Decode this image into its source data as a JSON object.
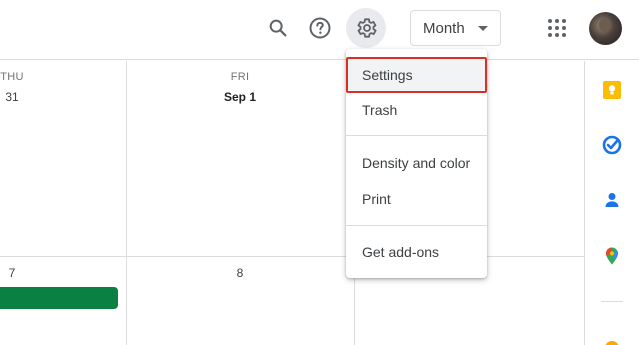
{
  "header": {
    "view_selector": {
      "label": "Month"
    }
  },
  "calendar": {
    "columns": [
      {
        "day_name": "THU",
        "date": "31"
      },
      {
        "day_name": "FRI",
        "date": "Sep 1"
      }
    ],
    "second_week_dates": [
      "7",
      "8"
    ],
    "event_color": "#0b8043"
  },
  "settings_menu": {
    "items": [
      {
        "label": "Settings"
      },
      {
        "label": "Trash"
      },
      {
        "label": "Density and color"
      },
      {
        "label": "Print"
      },
      {
        "label": "Get add-ons"
      }
    ]
  },
  "side_panel": {
    "icons": [
      "keep-icon",
      "tasks-icon",
      "contacts-icon",
      "maps-icon",
      "addon-icon"
    ]
  },
  "colors": {
    "highlight_border": "#d93025",
    "keep": "#fbbc04",
    "tasks": "#1a73e8",
    "contacts": "#1a73e8"
  }
}
